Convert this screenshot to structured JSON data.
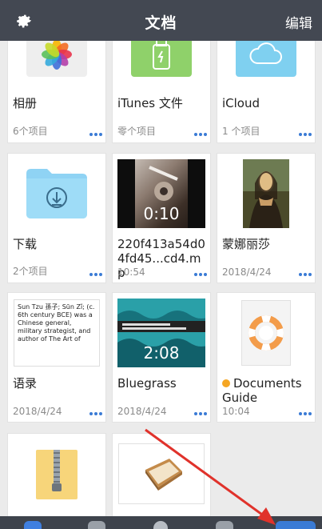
{
  "header": {
    "title": "文档",
    "edit_label": "编辑"
  },
  "items": [
    {
      "name": "相册",
      "meta": "6个项目"
    },
    {
      "name": "iTunes 文件",
      "meta": "零个项目"
    },
    {
      "name": "iCloud",
      "meta": "1 个项目"
    },
    {
      "name": "下载",
      "meta": "2个项目"
    },
    {
      "name": "220f413a54d04fd45...cd4.mp",
      "meta": "10:54",
      "duration": "0:10"
    },
    {
      "name": "蒙娜丽莎",
      "meta": "2018/4/24"
    },
    {
      "name": "语录",
      "meta": "2018/4/24",
      "preview": "Sun Tzu 孫子; Sūn Zǐ; (c. 6th century BCE) was a Chinese general, military strategist, and author of The Art of"
    },
    {
      "name": "Bluegrass",
      "meta": "2018/4/24",
      "duration": "2:08"
    },
    {
      "name": "Documents Guide",
      "meta": "10:04"
    }
  ],
  "colors": {
    "header_bg": "#434852",
    "accent": "#3a7bd5",
    "arrow": "#e0322b"
  }
}
